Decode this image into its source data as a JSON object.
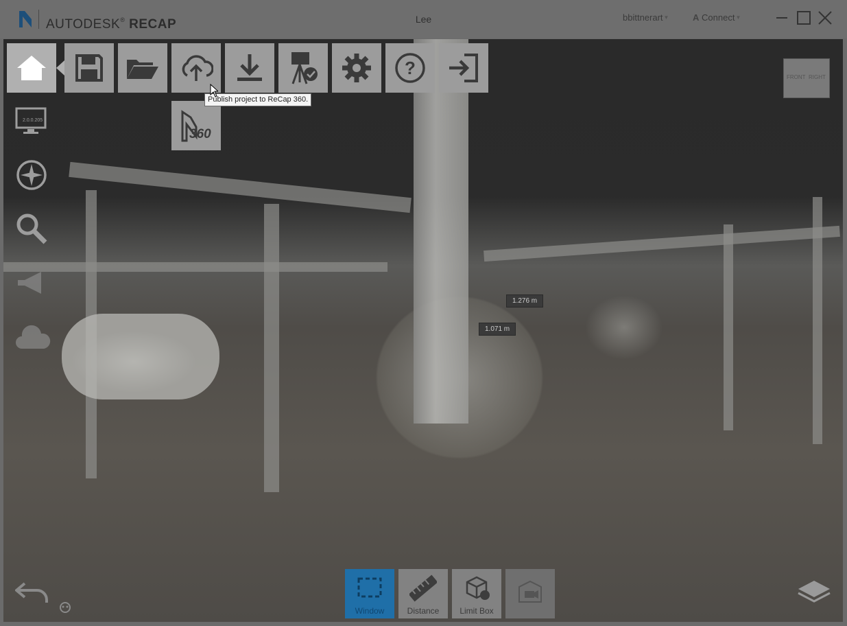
{
  "app": {
    "brand_light": "AUTODESK",
    "brand_bold": "RECAP",
    "document_title": "Lee",
    "user": "bbittnerart",
    "connect": "Connect"
  },
  "toolbar": {
    "items": [
      {
        "name": "home",
        "icon": "home-icon"
      },
      {
        "name": "save",
        "icon": "floppy-disk-icon"
      },
      {
        "name": "open",
        "icon": "folder-open-icon"
      },
      {
        "name": "publish",
        "icon": "cloud-upload-icon"
      },
      {
        "name": "import",
        "icon": "download-icon"
      },
      {
        "name": "scan-to-mesh",
        "icon": "survey-tripod-icon"
      },
      {
        "name": "settings",
        "icon": "gear-icon"
      },
      {
        "name": "help",
        "icon": "question-icon"
      },
      {
        "name": "exit",
        "icon": "exit-icon"
      }
    ],
    "submenu_label": "360",
    "tooltip": "Publish project to ReCap 360."
  },
  "side_tools": {
    "display_label": "2.0.0.205",
    "items": [
      "display-icon",
      "compass-icon",
      "magnifier-icon",
      "megaphone-icon",
      "cloud-icon"
    ]
  },
  "measurements": [
    "1.276 m",
    "1.071 m"
  ],
  "viewcube": {
    "front": "FRONT",
    "right": "RIGHT"
  },
  "bottom_tools": [
    {
      "label": "Window",
      "icon": "window-select-icon",
      "active": true
    },
    {
      "label": "Distance",
      "icon": "ruler-icon",
      "active": false
    },
    {
      "label": "Limit Box",
      "icon": "limit-box-icon",
      "active": false
    },
    {
      "label": "",
      "icon": "video-camera-icon",
      "active": false
    }
  ],
  "colors": {
    "accent": "#1f6fa8",
    "titlebar": "#6e6e6e"
  }
}
